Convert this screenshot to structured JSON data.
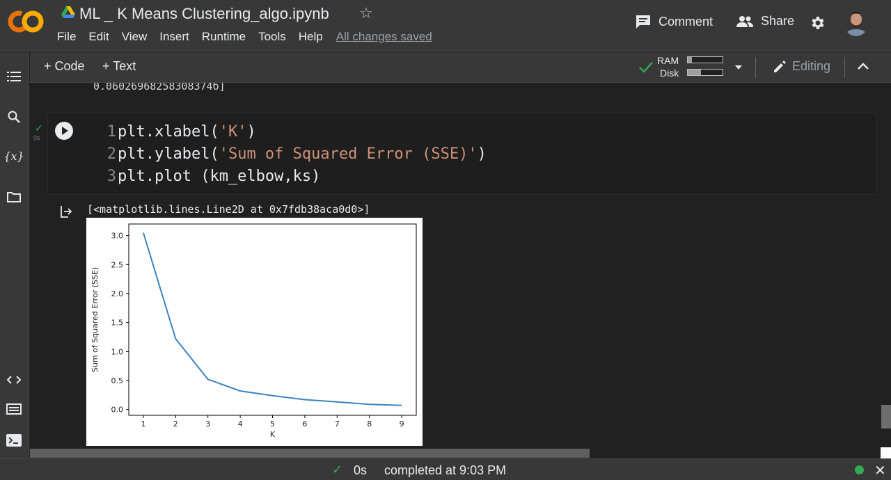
{
  "header": {
    "title": "ML _ K Means Clustering_algo.ipynb",
    "menu": [
      "File",
      "Edit",
      "View",
      "Insert",
      "Runtime",
      "Tools",
      "Help"
    ],
    "saved_status": "All changes saved",
    "comment_label": "Comment",
    "share_label": "Share"
  },
  "toolbar": {
    "code_label": "+ Code",
    "text_label": "+ Text",
    "ram_label": "RAM",
    "disk_label": "Disk",
    "ram_usage": 0.12,
    "disk_usage": 0.38,
    "editing_label": "Editing"
  },
  "cell": {
    "prev_output": "0.06026968258308374б]",
    "exec_time": "0s",
    "code_lines": [
      {
        "num": "1",
        "pre": "plt.xlabel(",
        "str": "'K'",
        "post": ")"
      },
      {
        "num": "2",
        "pre": "plt.ylabel(",
        "str": "'Sum of Squared Error (SSE)'",
        "post": ")"
      },
      {
        "num": "3",
        "pre": "plt.plot (km_elbow,ks)",
        "str": "",
        "post": ""
      }
    ],
    "output_text": "[<matplotlib.lines.Line2D at 0x7fdb38aca0d0>]"
  },
  "chart_data": {
    "type": "line",
    "xlabel": "K",
    "ylabel": "Sum of Squared Error (SSE)",
    "x": [
      1,
      2,
      3,
      4,
      5,
      6,
      7,
      8,
      9
    ],
    "y": [
      3.05,
      1.22,
      0.52,
      0.32,
      0.24,
      0.17,
      0.13,
      0.09,
      0.07
    ],
    "xlim": [
      0.55,
      9.45
    ],
    "ylim": [
      -0.1,
      3.2
    ],
    "xticks": [
      1,
      2,
      3,
      4,
      5,
      6,
      7,
      8,
      9
    ],
    "yticks": [
      0.0,
      0.5,
      1.0,
      1.5,
      2.0,
      2.5,
      3.0
    ],
    "line_color": "#3b83bd",
    "grid": false
  },
  "status": {
    "duration": "0s",
    "completed": "completed at 9:03 PM"
  },
  "colors": {
    "accent_green": "#34a853",
    "logo_orange": "#f9ab00",
    "string_color": "#ce9178"
  }
}
